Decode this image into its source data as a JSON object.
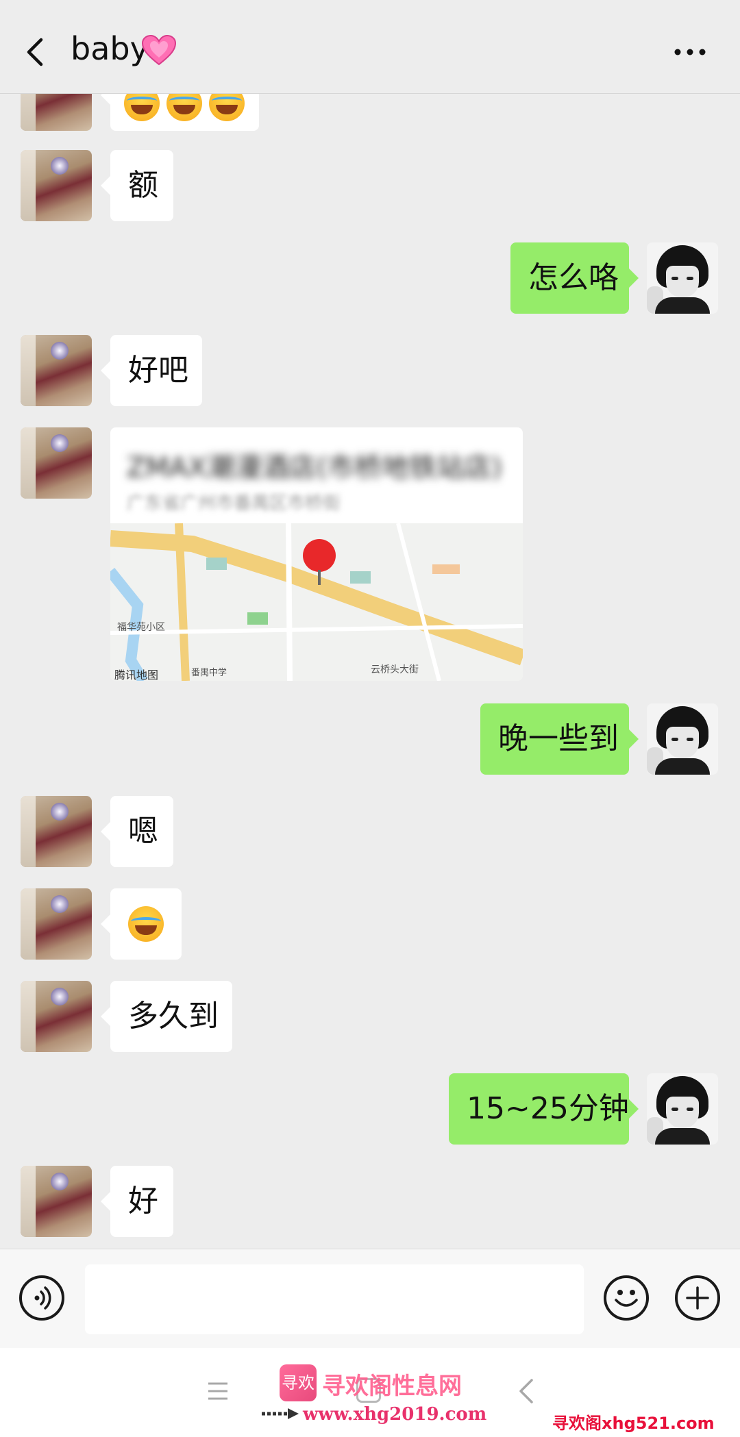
{
  "header": {
    "title": "baby",
    "title_emoji": "heart-icon"
  },
  "messages": [
    {
      "side": "her",
      "kind": "emoji",
      "content": "laughing-crying-emojis"
    },
    {
      "side": "her",
      "kind": "text",
      "text": "额"
    },
    {
      "side": "me",
      "kind": "text",
      "text": "怎么咯"
    },
    {
      "side": "her",
      "kind": "text",
      "text": "好吧"
    },
    {
      "side": "her",
      "kind": "location",
      "title": "ZMAX潮漫酒店(市桥地铁站店)",
      "address": "广东省广州市番禺区市桥街",
      "map_provider": "腾讯地图",
      "map_labels": [
        "福华苑小区",
        "番禺中学",
        "云桥头大街"
      ]
    },
    {
      "side": "me",
      "kind": "text",
      "text": "晚一些到"
    },
    {
      "side": "her",
      "kind": "text",
      "text": "嗯"
    },
    {
      "side": "her",
      "kind": "emoji",
      "content": "face-palm-crying-emoji"
    },
    {
      "side": "her",
      "kind": "text",
      "text": "多久到"
    },
    {
      "side": "me",
      "kind": "text",
      "text": "15~25分钟"
    },
    {
      "side": "her",
      "kind": "text",
      "text": "好"
    }
  ],
  "input_bar": {
    "value": "",
    "placeholder": ""
  },
  "watermark": {
    "logo_text": "寻欢",
    "name": "寻欢阁性息网",
    "url": "www.xhg2019.com",
    "corner": "寻欢阁xhg521.com"
  },
  "colors": {
    "background": "#ededed",
    "my_bubble": "#95ec69",
    "her_bubble": "#ffffff",
    "pin": "#e8282a"
  }
}
